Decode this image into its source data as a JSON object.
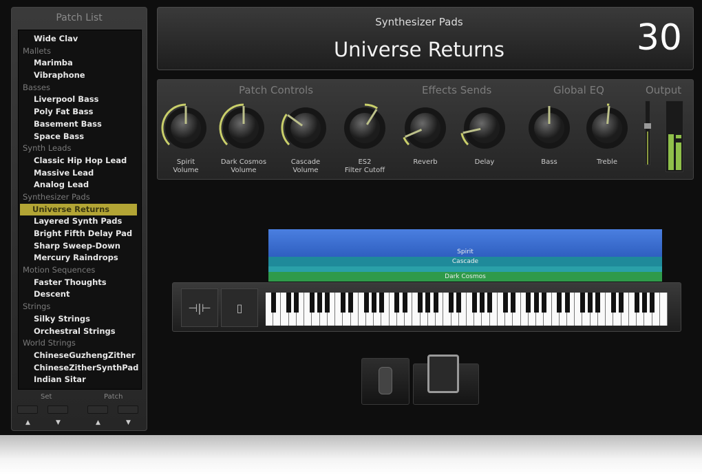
{
  "patch_list": {
    "title": "Patch List",
    "items": [
      {
        "label": "Wide Clav",
        "group": false
      },
      {
        "label": "Mallets",
        "group": true
      },
      {
        "label": "Marimba",
        "group": false
      },
      {
        "label": "Vibraphone",
        "group": false
      },
      {
        "label": "Basses",
        "group": true
      },
      {
        "label": "Liverpool Bass",
        "group": false
      },
      {
        "label": "Poly Fat Bass",
        "group": false
      },
      {
        "label": "Basement Bass",
        "group": false
      },
      {
        "label": "Space Bass",
        "group": false
      },
      {
        "label": "Synth Leads",
        "group": true
      },
      {
        "label": "Classic Hip Hop Lead",
        "group": false
      },
      {
        "label": "Massive Lead",
        "group": false
      },
      {
        "label": "Analog Lead",
        "group": false
      },
      {
        "label": "Synthesizer Pads",
        "group": true
      },
      {
        "label": "Universe Returns",
        "group": false,
        "selected": true
      },
      {
        "label": "Layered Synth Pads",
        "group": false
      },
      {
        "label": "Bright Fifth Delay Pad",
        "group": false
      },
      {
        "label": "Sharp Sweep-Down",
        "group": false
      },
      {
        "label": "Mercury Raindrops",
        "group": false
      },
      {
        "label": "Motion Sequences",
        "group": true
      },
      {
        "label": "Faster Thoughts",
        "group": false
      },
      {
        "label": "Descent",
        "group": false
      },
      {
        "label": "Strings",
        "group": true
      },
      {
        "label": "Silky Strings",
        "group": false
      },
      {
        "label": "Orchestral Strings",
        "group": false
      },
      {
        "label": "World Strings",
        "group": true
      },
      {
        "label": "ChineseGuzhengZither",
        "group": false
      },
      {
        "label": "ChineseZitherSynthPad",
        "group": false
      },
      {
        "label": "Indian Sitar",
        "group": false
      }
    ],
    "set_label": "Set",
    "patch_label": "Patch",
    "up": "▲",
    "down": "▼"
  },
  "header": {
    "set_name": "Synthesizer Pads",
    "patch_name": "Universe Returns",
    "patch_number": "30"
  },
  "controls": {
    "sections": [
      "Patch Controls",
      "Effects Sends",
      "Global EQ",
      "Output"
    ],
    "knobs": [
      {
        "line1": "Spirit",
        "line2": "Volume",
        "value": 0.5
      },
      {
        "line1": "Dark Cosmos",
        "line2": "Volume",
        "value": 0.5
      },
      {
        "line1": "Cascade",
        "line2": "Volume",
        "value": 0.3
      },
      {
        "line1": "ES2",
        "line2": "Filter Cutoff",
        "value": 0.62,
        "arc_from": 0.5
      },
      {
        "line1": "Reverb",
        "line2": "",
        "value": 0.08
      },
      {
        "line1": "Delay",
        "line2": "",
        "value": 0.12
      },
      {
        "line1": "Bass",
        "line2": "",
        "value": 0.5,
        "arc_from": 0.5
      },
      {
        "line1": "Treble",
        "line2": "",
        "value": 0.52,
        "arc_from": 0.5
      }
    ],
    "accent": "#c9cf6a"
  },
  "layers": [
    {
      "name": "Spirit",
      "color": "#3a6fd0"
    },
    {
      "name": "Cascade",
      "color": "#1f8a9a"
    },
    {
      "name": "Dark Cosmos",
      "color": "#2f9a4a"
    }
  ],
  "keyboard": {
    "pitch_icon": "pitch-bend-icon",
    "mod_icon": "mod-wheel-icon"
  }
}
